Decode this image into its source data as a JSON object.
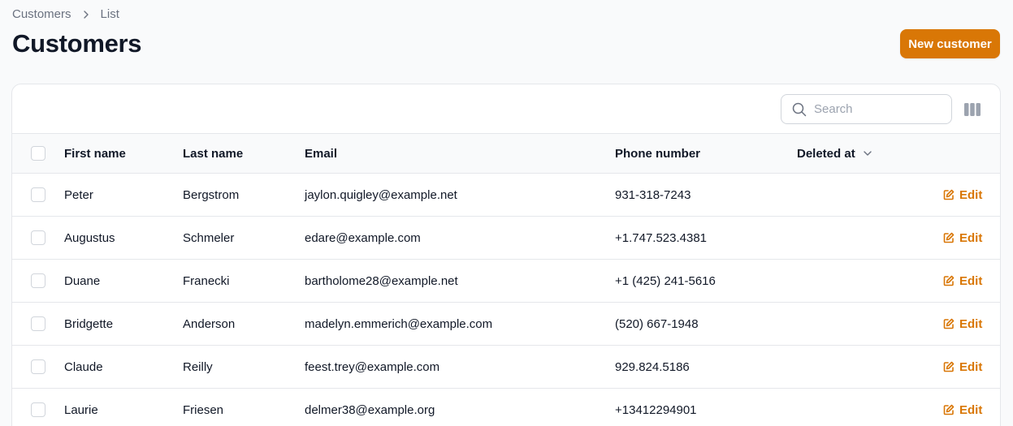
{
  "breadcrumb": {
    "items": [
      "Customers",
      "List"
    ]
  },
  "page": {
    "title": "Customers"
  },
  "actions": {
    "new_label": "New customer"
  },
  "search": {
    "placeholder": "Search",
    "value": ""
  },
  "table": {
    "columns": [
      "First name",
      "Last name",
      "Email",
      "Phone number",
      "Deleted at"
    ],
    "edit_label": "Edit",
    "rows": [
      {
        "first": "Peter",
        "last": "Bergstrom",
        "email": "jaylon.quigley@example.net",
        "phone": "931-318-7243",
        "deleted": ""
      },
      {
        "first": "Augustus",
        "last": "Schmeler",
        "email": "edare@example.com",
        "phone": "+1.747.523.4381",
        "deleted": ""
      },
      {
        "first": "Duane",
        "last": "Franecki",
        "email": "bartholome28@example.net",
        "phone": "+1 (425) 241-5616",
        "deleted": ""
      },
      {
        "first": "Bridgette",
        "last": "Anderson",
        "email": "madelyn.emmerich@example.com",
        "phone": "(520) 667-1948",
        "deleted": ""
      },
      {
        "first": "Claude",
        "last": "Reilly",
        "email": "feest.trey@example.com",
        "phone": "929.824.5186",
        "deleted": ""
      },
      {
        "first": "Laurie",
        "last": "Friesen",
        "email": "delmer38@example.org",
        "phone": "+13412294901",
        "deleted": ""
      }
    ]
  },
  "colors": {
    "accent": "#d97706",
    "border": "#e5e7eb",
    "muted": "#6b7280"
  },
  "icons": {
    "breadcrumb_separator": "chevron-right-icon",
    "search": "search-icon",
    "columns": "columns-icon",
    "sort": "chevron-down-icon",
    "edit": "edit-icon"
  }
}
